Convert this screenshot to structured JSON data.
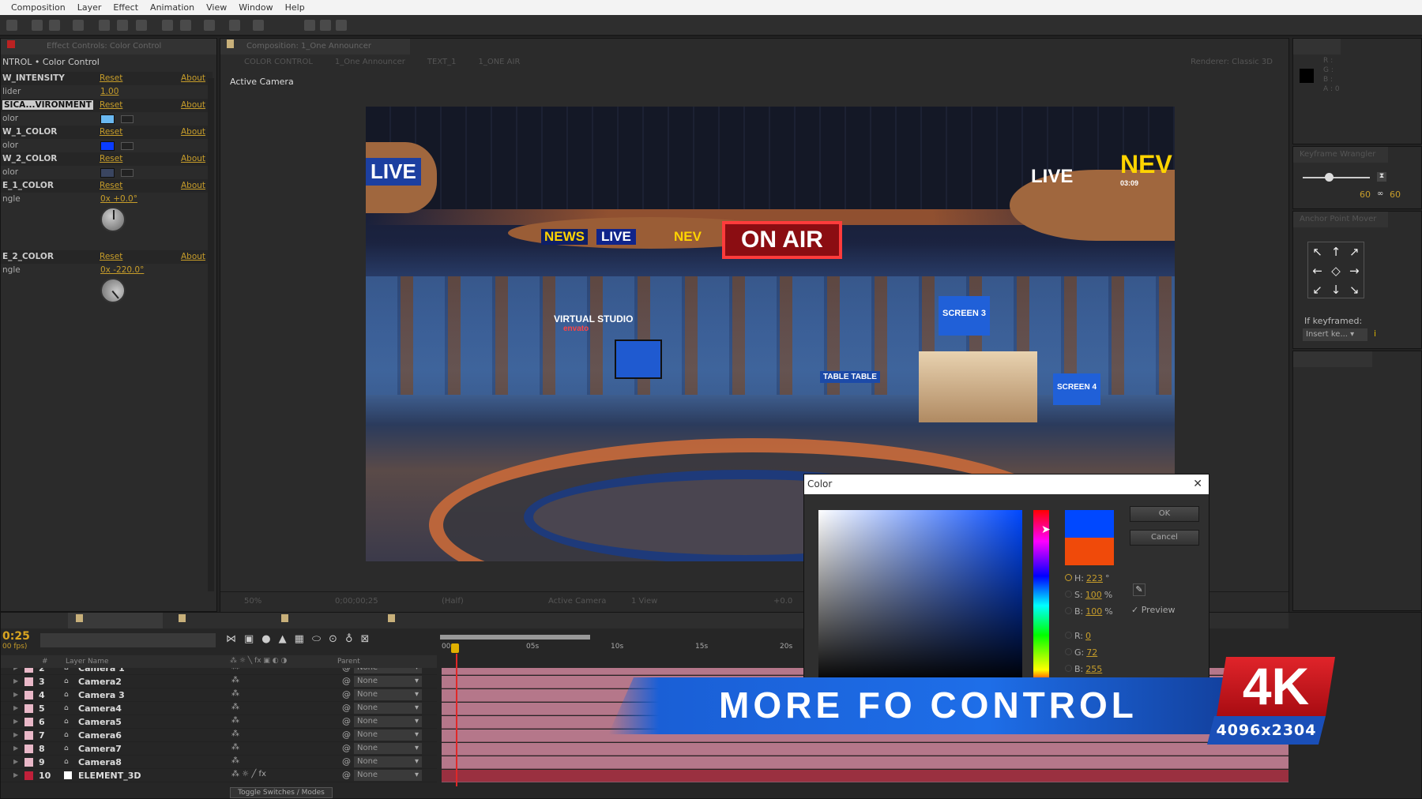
{
  "menu": [
    "Composition",
    "Layer",
    "Effect",
    "Animation",
    "View",
    "Window",
    "Help"
  ],
  "effect_panel": {
    "tab": "Effect Controls: Color Control",
    "header": "NTROL • Color Control",
    "rows": [
      {
        "kind": "group",
        "name": "W_INTENSITY",
        "reset": "Reset",
        "about": "About"
      },
      {
        "kind": "value",
        "name": "lider",
        "value": "1.00"
      },
      {
        "kind": "group",
        "name": "SICA...VIRONMENT",
        "reset": "Reset",
        "about": "About",
        "selected": true
      },
      {
        "kind": "color",
        "name": "olor",
        "color": "#6ab8f0"
      },
      {
        "kind": "group",
        "name": "W_1_COLOR",
        "reset": "Reset",
        "about": "About"
      },
      {
        "kind": "color",
        "name": "olor",
        "color": "#0a3cff"
      },
      {
        "kind": "group",
        "name": "W_2_COLOR",
        "reset": "Reset",
        "about": "About"
      },
      {
        "kind": "color",
        "name": "olor",
        "color": "#3a4560"
      },
      {
        "kind": "group",
        "name": "E_1_COLOR",
        "reset": "Reset",
        "about": "About"
      },
      {
        "kind": "angle",
        "name": "ngle",
        "value": "0x +0.0°"
      },
      {
        "kind": "group",
        "name": "E_2_COLOR",
        "reset": "Reset",
        "about": "About"
      },
      {
        "kind": "angle",
        "name": "ngle",
        "value": "0x -220.0°"
      }
    ]
  },
  "viewer": {
    "tab": "Composition: 1_One Announcer",
    "breadcrumbs": [
      "COLOR CONTROL",
      "1_One Announcer",
      "TEXT_1",
      "1_ONE AIR"
    ],
    "renderer": "Renderer: Classic 3D",
    "camera_label": "Active Camera",
    "footer": {
      "zoom": "50%",
      "timecode": "0;00;00;25",
      "resolution": "(Half)",
      "camera": "Active Camera",
      "views": "1 View",
      "exposure": "+0.0"
    },
    "studio_signs": {
      "on_air": "ON AIR",
      "live": "LIVE",
      "news": "NEWS",
      "news2": "NEV",
      "time": "03:09",
      "virtual": "VIRTUAL STUDIO",
      "envato": "envato",
      "screen3": "SCREEN 3",
      "screen4": "SCREEN 4",
      "table": "TABLE TABLE"
    }
  },
  "right": {
    "info_values": [
      "R :",
      "G :",
      "B :",
      "A : 0"
    ],
    "keyframe_panel": "Keyframe Wrangler",
    "keyframe_values": [
      "60",
      "60"
    ],
    "anchor_panel": "Anchor Point Mover",
    "if_keyframed": "If keyframed:",
    "insert_select": "Insert ke..."
  },
  "timeline": {
    "timecode": "0:25",
    "fps": "00 fps)",
    "col_headers": {
      "num": "#",
      "name": "Layer Name",
      "parent": "Parent"
    },
    "ruler": [
      "00s",
      "05s",
      "10s",
      "15s",
      "20s"
    ],
    "layers": [
      {
        "num": "2",
        "name": "Camera 1",
        "parent": "None"
      },
      {
        "num": "3",
        "name": "Camera2",
        "parent": "None"
      },
      {
        "num": "4",
        "name": "Camera 3",
        "parent": "None"
      },
      {
        "num": "5",
        "name": "Camera4",
        "parent": "None"
      },
      {
        "num": "6",
        "name": "Camera5",
        "parent": "None"
      },
      {
        "num": "7",
        "name": "Camera6",
        "parent": "None"
      },
      {
        "num": "8",
        "name": "Camera7",
        "parent": "None"
      },
      {
        "num": "9",
        "name": "Camera8",
        "parent": "None"
      },
      {
        "num": "10",
        "name": "ELEMENT_3D",
        "parent": "None"
      }
    ],
    "toggle": "Toggle Switches / Modes"
  },
  "color_dialog": {
    "title": "Color",
    "ok": "OK",
    "cancel": "Cancel",
    "preview": "Preview",
    "new_color": "#0048ff",
    "old_color": "#f04a0a",
    "fields": [
      {
        "label": "H:",
        "value": "223",
        "unit": "°"
      },
      {
        "label": "S:",
        "value": "100",
        "unit": "%"
      },
      {
        "label": "B:",
        "value": "100",
        "unit": "%"
      },
      {
        "label": "R:",
        "value": "0",
        "unit": ""
      },
      {
        "label": "G:",
        "value": "72",
        "unit": ""
      },
      {
        "label": "B:",
        "value": "255",
        "unit": ""
      }
    ]
  },
  "overlay": {
    "banner": "MORE FO CONTROL",
    "badge": "4K",
    "resolution": "4096x2304"
  }
}
